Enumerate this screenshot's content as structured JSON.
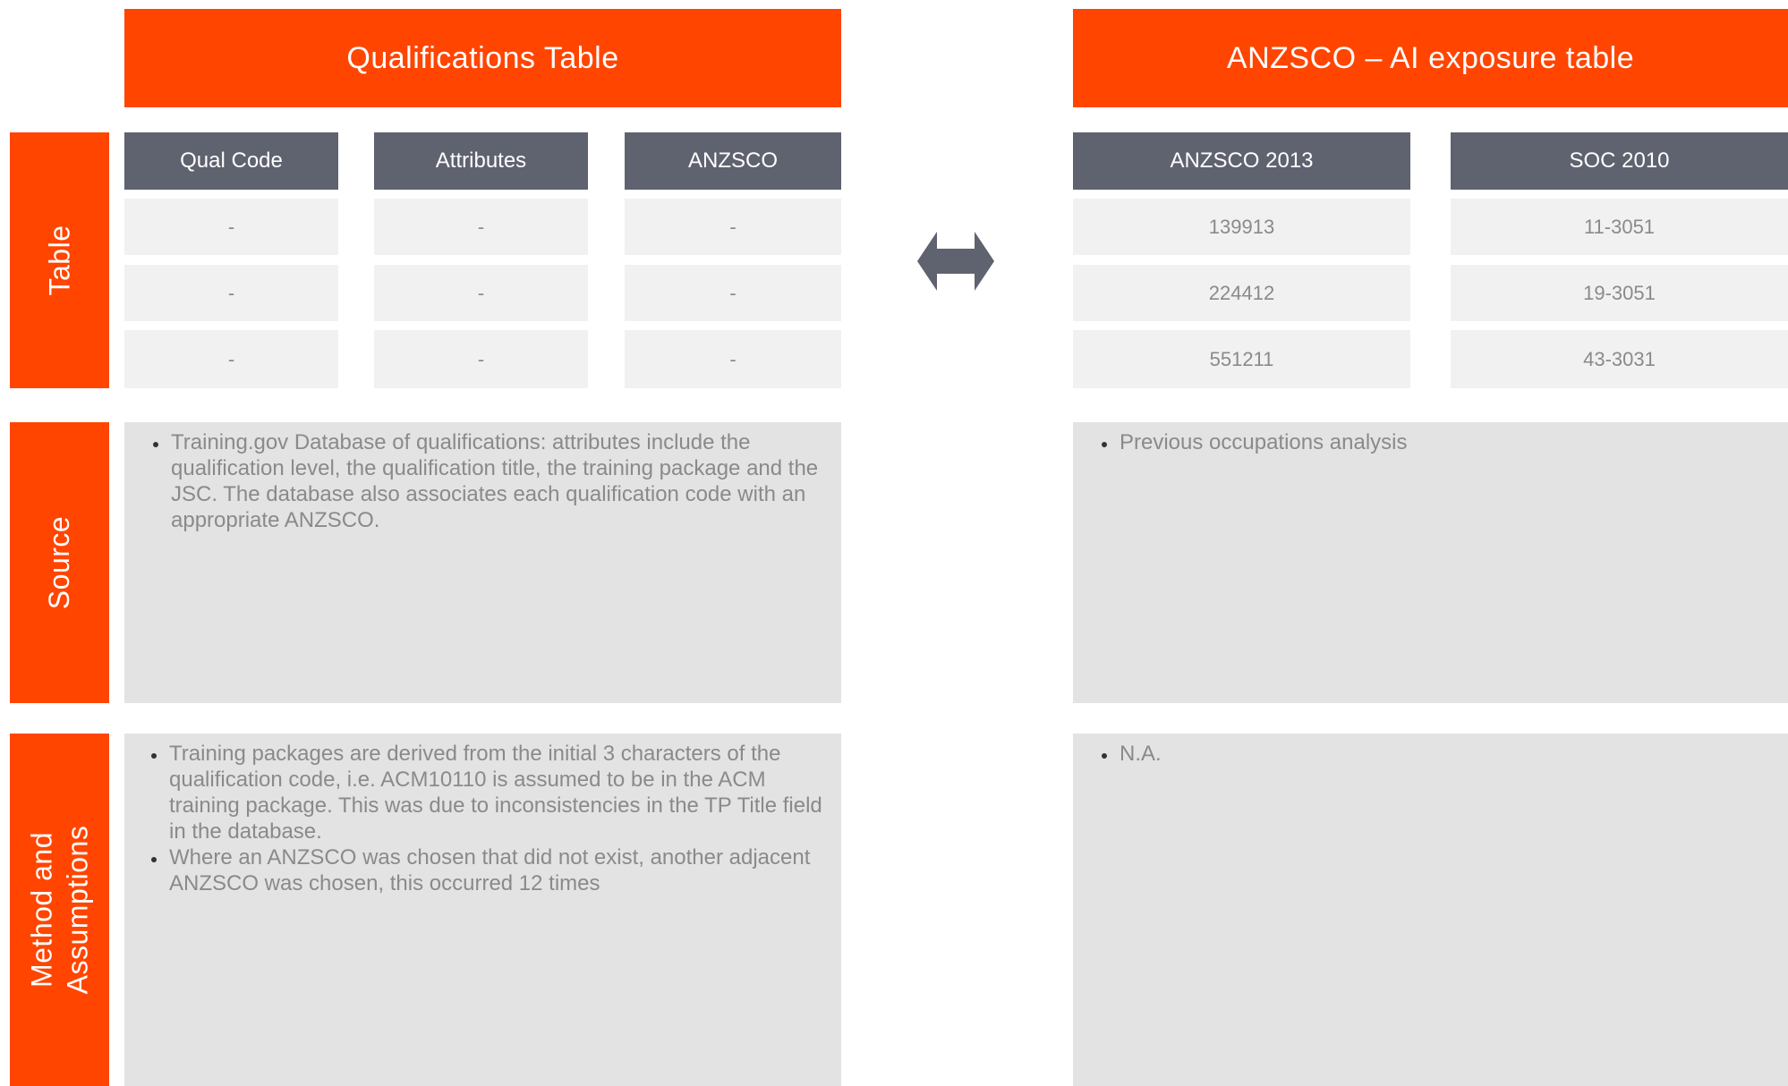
{
  "left_panel": {
    "title": "Qualifications Table",
    "columns": [
      "Qual Code",
      "Attributes",
      "ANZSCO"
    ],
    "rows": [
      [
        "-",
        "-",
        "-"
      ],
      [
        "-",
        "-",
        "-"
      ],
      [
        "-",
        "-",
        "-"
      ]
    ],
    "source_items": [
      "Training.gov Database of qualifications: attributes include the qualification level, the qualification title, the training package and the JSC. The database also associates each qualification code with an appropriate ANZSCO."
    ],
    "method_items": [
      "Training packages are derived from the initial 3 characters of the qualification code, i.e. ACM10110 is assumed to be in the ACM training package. This was due to inconsistencies in the TP Title field in the database.",
      "Where an ANZSCO was chosen that did not exist, another adjacent ANZSCO was chosen, this occurred 12 times"
    ]
  },
  "right_panel": {
    "title": "ANZSCO – AI exposure table",
    "columns": [
      "ANZSCO 2013",
      "SOC 2010"
    ],
    "rows": [
      [
        "139913",
        "11-3051"
      ],
      [
        "224412",
        "19-3051"
      ],
      [
        "551211",
        "43-3031"
      ]
    ],
    "source_items": [
      "Previous occupations analysis"
    ],
    "method_items": [
      "N.A."
    ]
  },
  "row_labels": {
    "table": "Table",
    "source": "Source",
    "method_line1": "Method and",
    "method_line2": "Assumptions"
  },
  "connector": {
    "icon": "double-arrow-icon",
    "color": "#5f626f"
  },
  "colors": {
    "accent": "#ff4500",
    "header_grey": "#5f626f",
    "cell_bg": "#f1f1f1",
    "box_bg": "#e3e3e3",
    "text_grey": "#8a8a8a"
  }
}
